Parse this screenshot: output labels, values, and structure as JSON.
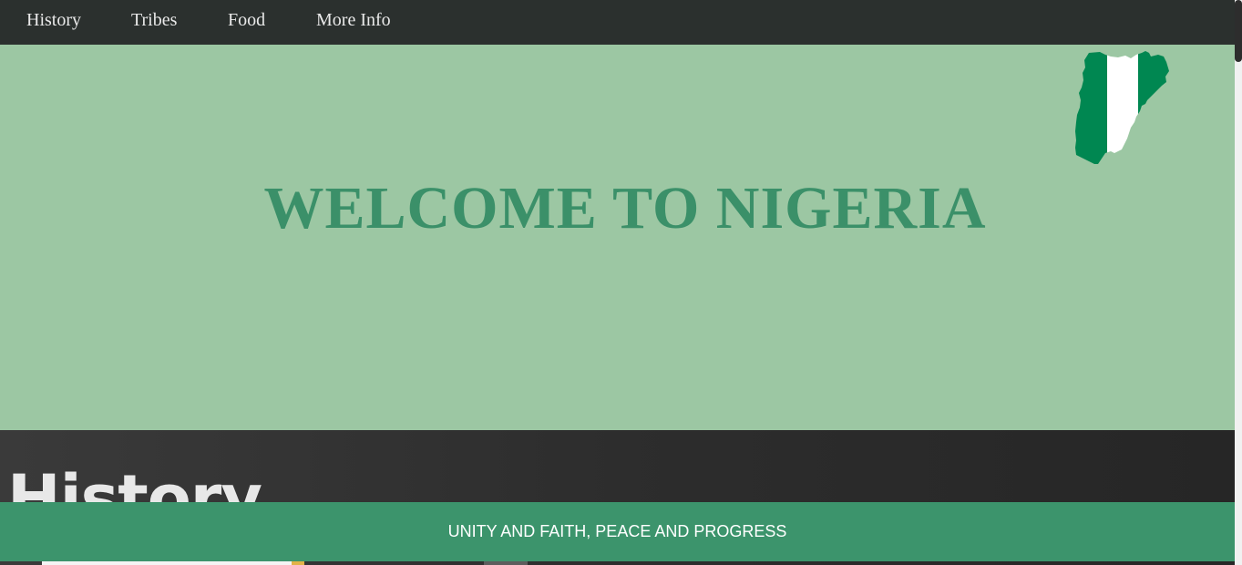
{
  "nav": {
    "items": [
      {
        "label": "History"
      },
      {
        "label": "Tribes"
      },
      {
        "label": "Food"
      },
      {
        "label": "More Info"
      }
    ]
  },
  "hero": {
    "title": "WELCOME TO NIGERIA",
    "map_icon": "nigeria-flag-map-icon"
  },
  "history": {
    "heading": "History"
  },
  "footer": {
    "motto": "UNITY AND FAITH, PEACE AND PROGRESS"
  },
  "colors": {
    "nav_bg": "#2b302e",
    "hero_bg": "#9cc7a3",
    "accent_green": "#3b9069",
    "footer_bg": "#3c946c",
    "flag_green": "#008751",
    "flag_white": "#ffffff"
  }
}
